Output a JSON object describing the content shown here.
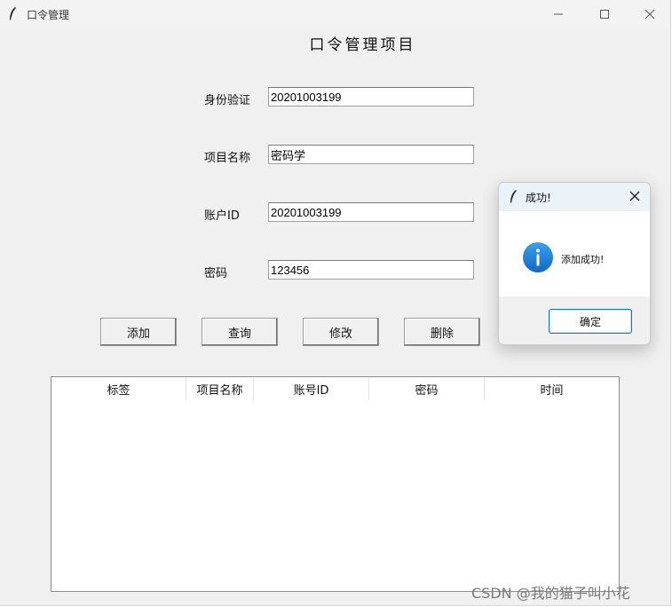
{
  "window": {
    "title": "口令管理",
    "heading": "口令管理项目"
  },
  "form": {
    "fields": [
      {
        "label": "身份验证",
        "value": "20201003199"
      },
      {
        "label": "项目名称",
        "value": "密码学"
      },
      {
        "label": "账户ID",
        "value": "20201003199"
      },
      {
        "label": "密码",
        "value": "123456"
      }
    ]
  },
  "buttons": {
    "add": "添加",
    "query": "查询",
    "modify": "修改",
    "delete": "删除"
  },
  "table": {
    "columns": [
      "标签",
      "项目名称",
      "账号ID",
      "密码",
      "时间"
    ],
    "rows": []
  },
  "dialog": {
    "title": "成功!",
    "message": "添加成功!",
    "ok_label": "确定"
  },
  "watermark": "CSDN @我的猫子叫小花",
  "colors": {
    "info_icon": "#1a7fd6",
    "dialog_button_border": "#1f6fc8"
  },
  "icons": {
    "app": "feather-icon",
    "info": "info-icon"
  }
}
